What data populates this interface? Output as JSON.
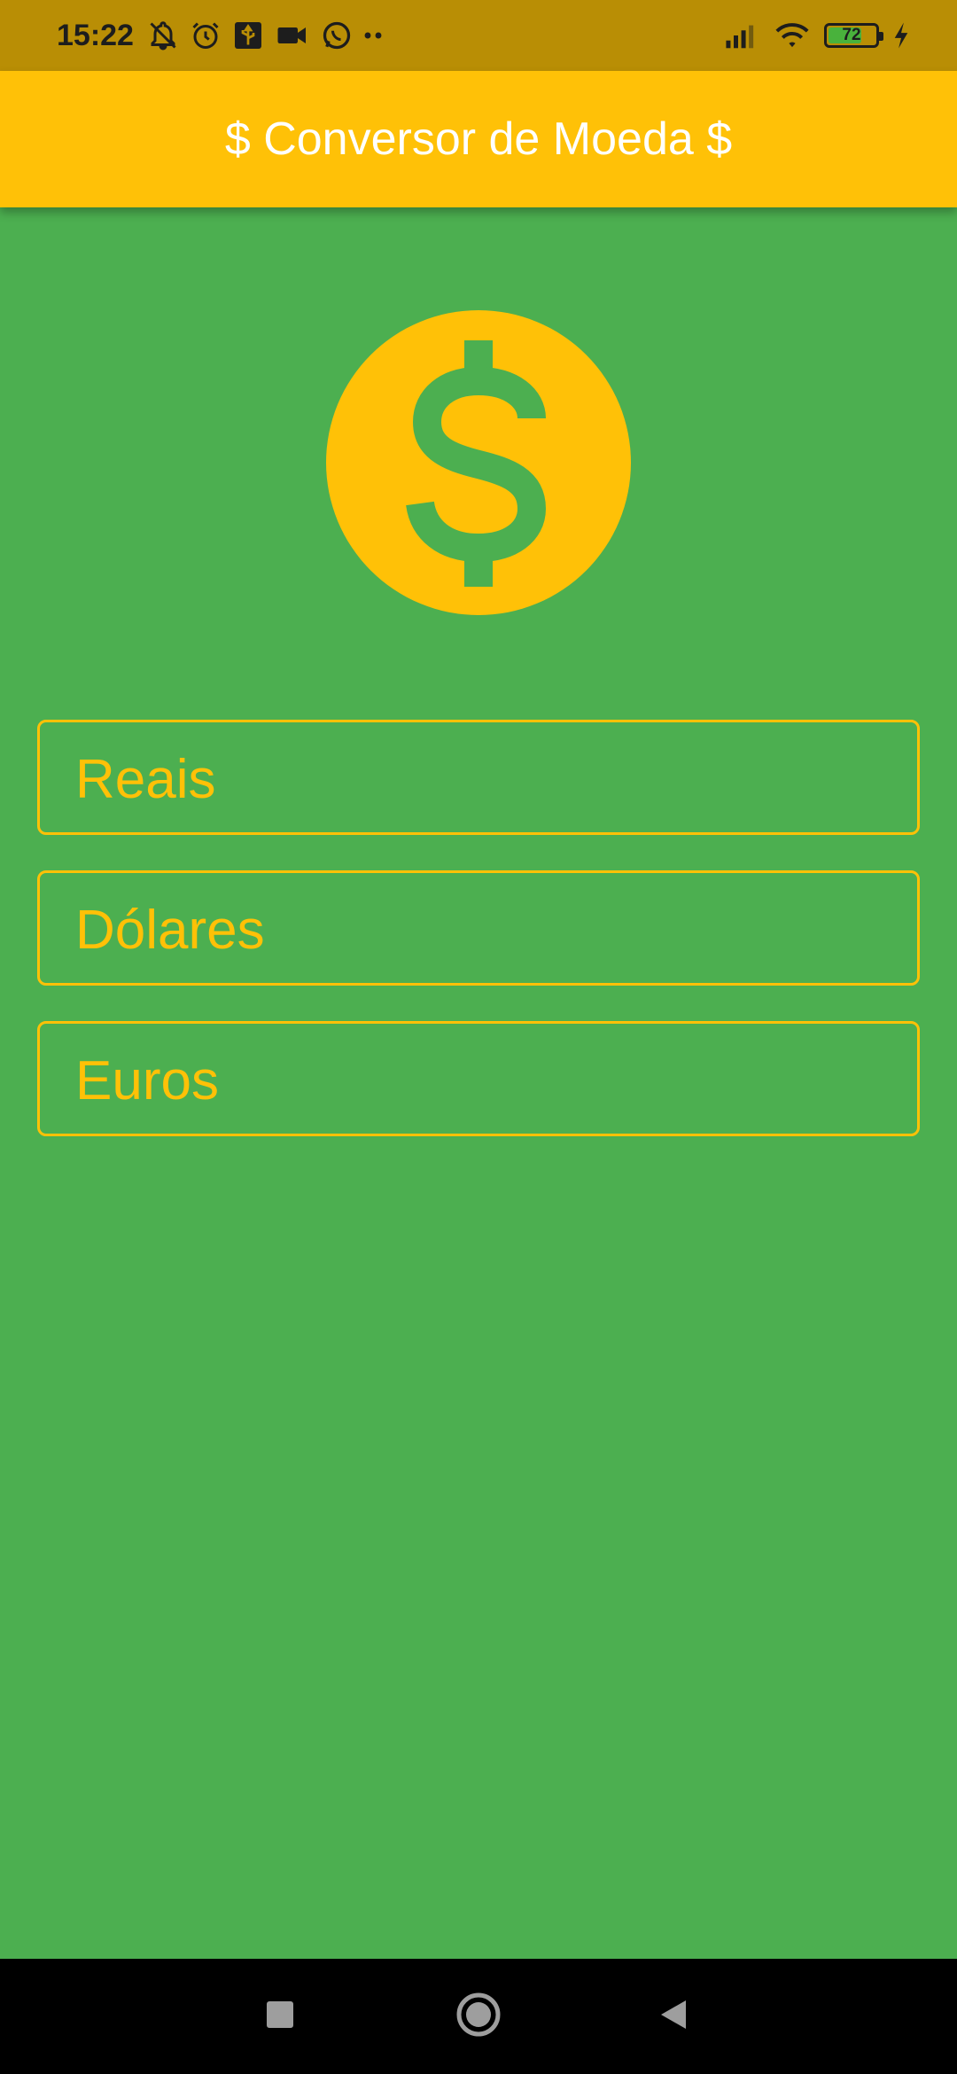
{
  "status_bar": {
    "time": "15:22",
    "battery_level": "72",
    "battery_fraction": 0.72,
    "left_icons": [
      "notifications-off-icon",
      "alarm-icon",
      "usb-icon",
      "video-icon",
      "whatsapp-icon",
      "more-dots-icon"
    ],
    "right_icons": [
      "signal-icon",
      "wifi-icon",
      "battery-icon",
      "charging-icon"
    ]
  },
  "app_bar": {
    "title": "$ Conversor de Moeda $"
  },
  "main": {
    "logo_icon": "monetization-icon",
    "fields": [
      {
        "label": "Reais"
      },
      {
        "label": "Dólares"
      },
      {
        "label": "Euros"
      }
    ]
  },
  "nav_bar": {
    "buttons": [
      "recents-icon",
      "home-icon",
      "back-icon"
    ]
  },
  "colors": {
    "background": "#4caf50",
    "accent": "#ffc107",
    "status_bar": "#b98e05",
    "nav_bar": "#000000",
    "title_text": "#ffffff"
  }
}
